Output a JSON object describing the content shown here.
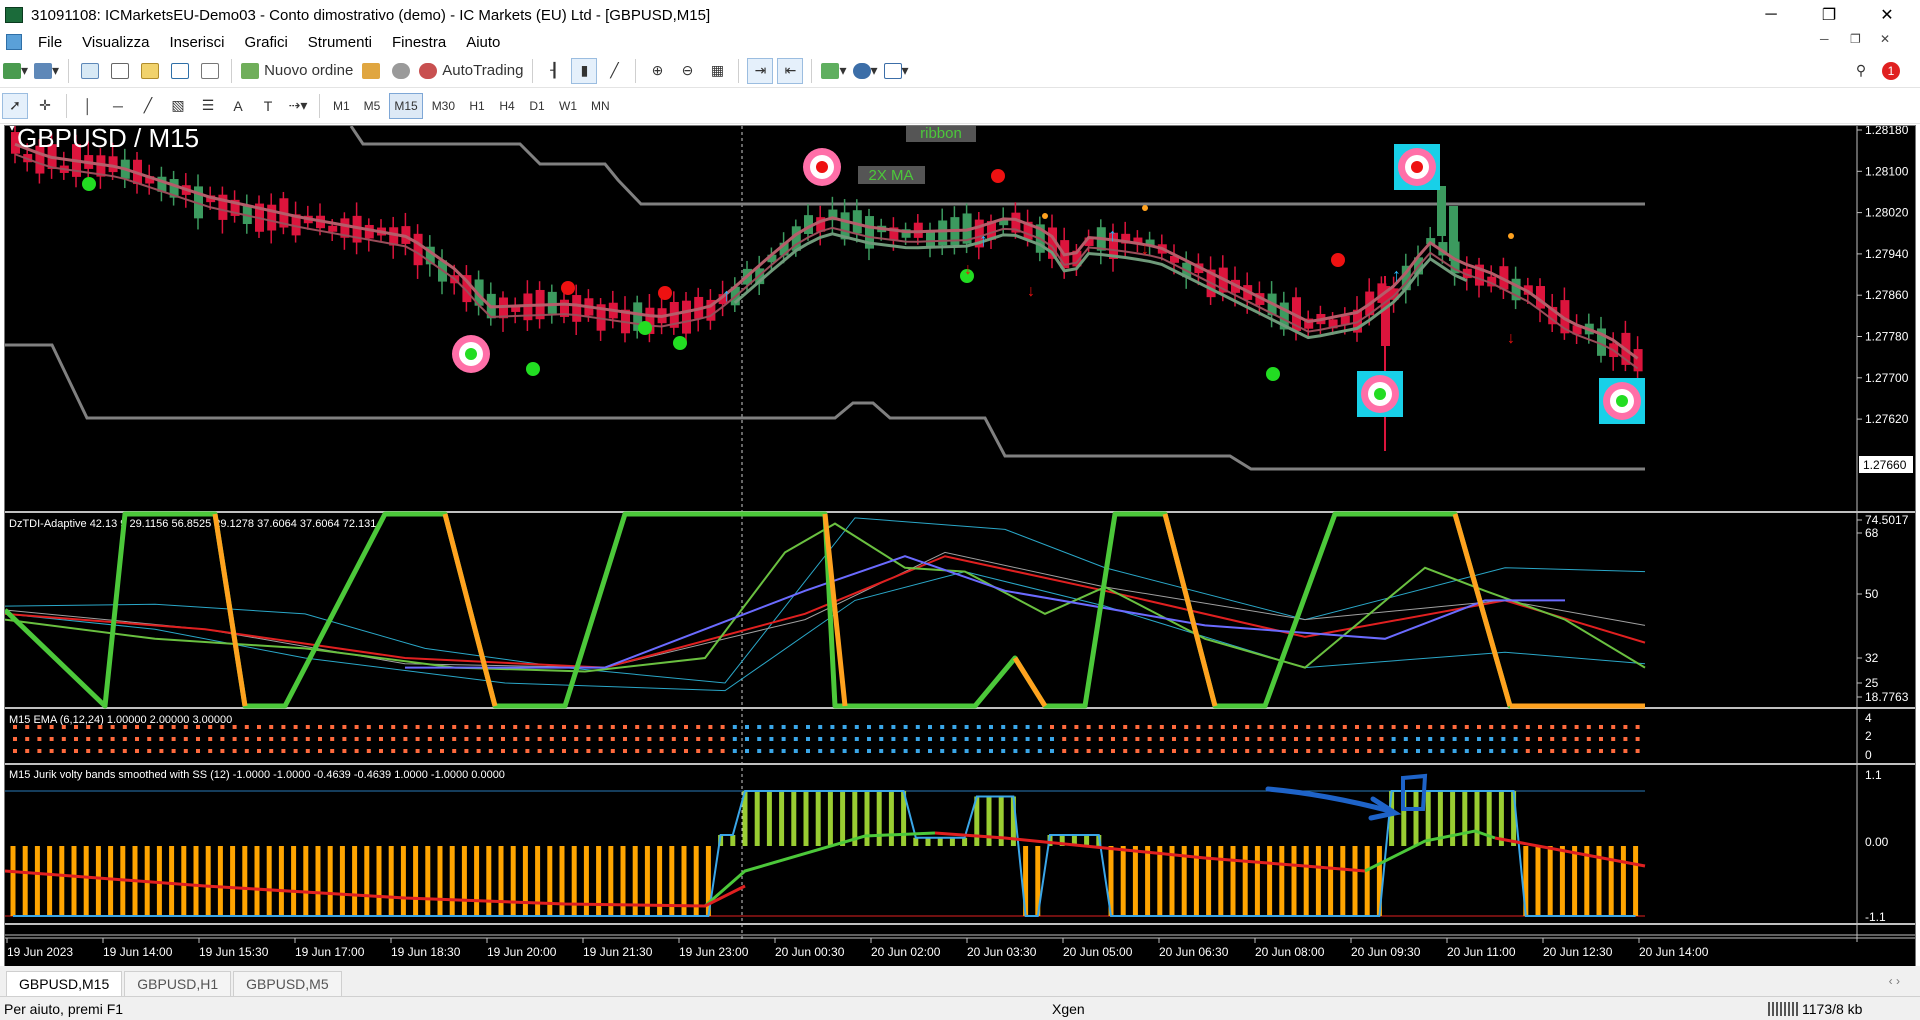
{
  "window": {
    "title": "31091108: ICMarketsEU-Demo03 - Conto dimostrativo (demo) - IC Markets (EU) Ltd - [GBPUSD,M15]",
    "controls": [
      "─",
      "❐",
      "✕"
    ]
  },
  "menu": [
    "File",
    "Visualizza",
    "Inserisci",
    "Grafici",
    "Strumenti",
    "Finestra",
    "Aiuto"
  ],
  "toolbar": {
    "new_order": "Nuovo ordine",
    "autotrading": "AutoTrading",
    "notification_count": "1"
  },
  "timeframes": [
    "M1",
    "M5",
    "M15",
    "M30",
    "H1",
    "H4",
    "D1",
    "W1",
    "MN"
  ],
  "timeframe_selected": "M15",
  "chart": {
    "symbol_title": "GBPUSD / M15",
    "label_ribbon": "ribbon",
    "label_2xma": "2X MA",
    "price_axis": [
      "1.28180",
      "1.28100",
      "1.28020",
      "1.27940",
      "1.27860",
      "1.27780",
      "1.27700",
      "1.27620"
    ],
    "current_price": "1.27660",
    "time_axis": [
      "19 Jun 2023",
      "19 Jun 14:00",
      "19 Jun 15:30",
      "19 Jun 17:00",
      "19 Jun 18:30",
      "19 Jun 20:00",
      "19 Jun 21:30",
      "19 Jun 23:00",
      "20 Jun 00:30",
      "20 Jun 02:00",
      "20 Jun 03:30",
      "20 Jun 05:00",
      "20 Jun 06:30",
      "20 Jun 08:00",
      "20 Jun 09:30",
      "20 Jun 11:00",
      "20 Jun 12:30",
      "20 Jun 14:00"
    ],
    "tdi_label": "DzTDI-Adaptive 42.13 9 29.1156 56.8525 29.1278 37.6064 37.6064 72.131",
    "tdi_axis": [
      "74.5017",
      "68",
      "50",
      "32",
      "25",
      "18.7763"
    ],
    "ema_label": "M15 EMA (6,12,24) 1.00000 2.00000 3.00000",
    "ema_axis": [
      "4",
      "2",
      "0"
    ],
    "jurik_label": "M15 Jurik volty bands smoothed with SS (12) -1.0000 -1.0000 -0.4639 -0.4639 1.0000 -1.0000 0.0000",
    "jurik_axis": [
      "1.1",
      "0.00",
      "-1.1"
    ]
  },
  "colors": {
    "bull": "#3c9a5f",
    "bear": "#dc143c",
    "ma": "#b55d6a",
    "band": "#808080",
    "tdi_green": "#4cc83a",
    "tdi_orange": "#ffa21f",
    "hist_green": "#9acd32",
    "hist_orange": "#ffa500"
  },
  "tabs": [
    "GBPUSD,M15",
    "GBPUSD,H1",
    "GBPUSD,M5"
  ],
  "status": {
    "help": "Per aiuto, premi F1",
    "profile": "Xgen",
    "traffic": "1173/8 kb"
  }
}
